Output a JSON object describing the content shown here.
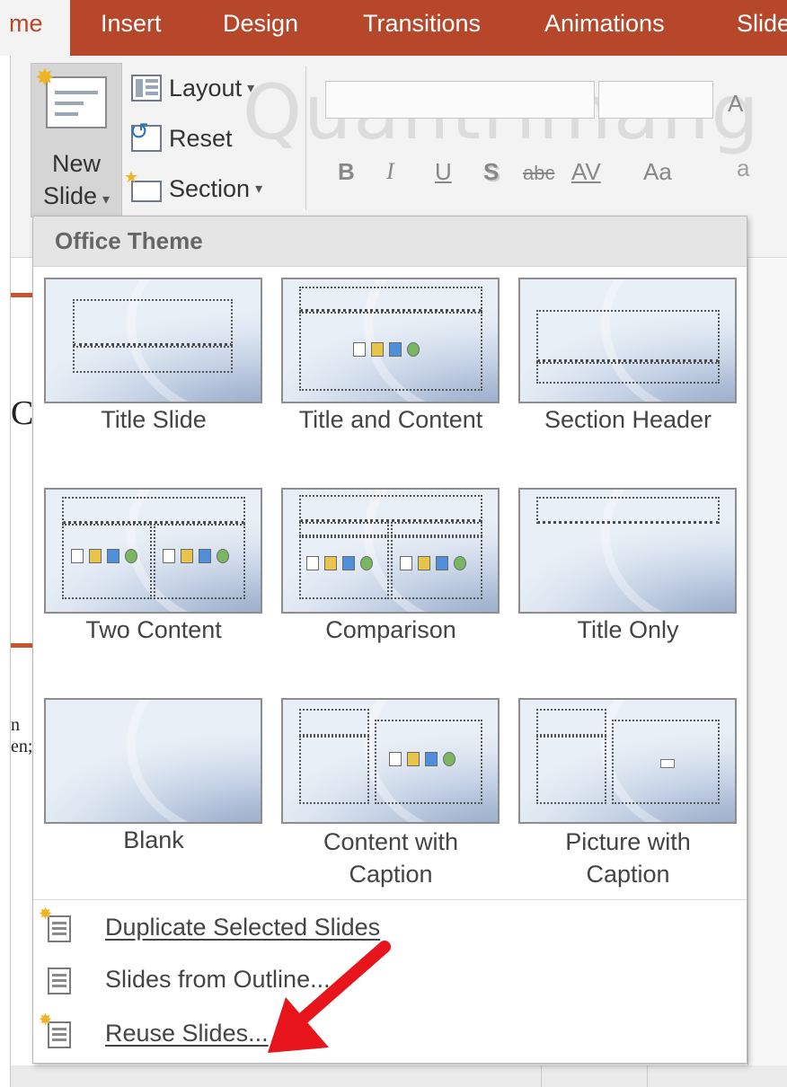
{
  "ribbon": {
    "tabs": [
      {
        "label": "me",
        "active": true
      },
      {
        "label": "Insert",
        "active": false
      },
      {
        "label": "Design",
        "active": false
      },
      {
        "label": "Transitions",
        "active": false
      },
      {
        "label": "Animations",
        "active": false
      },
      {
        "label": "Slide",
        "active": false
      }
    ],
    "new_slide": {
      "line1": "New",
      "line2": "Slide",
      "caret": "▾"
    },
    "slides_group": {
      "layout": "Layout",
      "reset": "Reset",
      "section": "Section",
      "caret": "▾"
    },
    "font_group": {
      "bold": "B",
      "italic": "I",
      "underline": "U",
      "shadow": "S",
      "strikethrough": "abc",
      "spacing": "AV",
      "change_case": "Aa",
      "grow_font": "A",
      "clear_format": "a"
    },
    "watermark": "Quantrimang"
  },
  "background": {
    "side_letter_top": "C",
    "side_letters_bottom": [
      "n",
      "en;"
    ]
  },
  "dropdown": {
    "header": "Office Theme",
    "layouts": [
      {
        "name": "Title Slide"
      },
      {
        "name": "Title and Content"
      },
      {
        "name": "Section Header"
      },
      {
        "name": "Two Content"
      },
      {
        "name": "Comparison"
      },
      {
        "name": "Title Only"
      },
      {
        "name": "Blank"
      },
      {
        "name": "Content with Caption",
        "line1": "Content with",
        "line2": "Caption"
      },
      {
        "name": "Picture with Caption",
        "line1": "Picture with",
        "line2": "Caption"
      }
    ],
    "menu_items": [
      {
        "label": "Duplicate Selected Slides",
        "icon": "duplicate-slides-icon"
      },
      {
        "label": "Slides from Outline...",
        "icon": "outline-icon"
      },
      {
        "label": "Reuse Slides...",
        "icon": "reuse-slides-icon"
      }
    ]
  },
  "annotation": {
    "arrow_color": "#e8141c"
  },
  "colors": {
    "ribbon_accent": "#b7472a",
    "ribbon_bg": "#f3f3f3",
    "thumbnail_blue": "#a9bad4"
  }
}
